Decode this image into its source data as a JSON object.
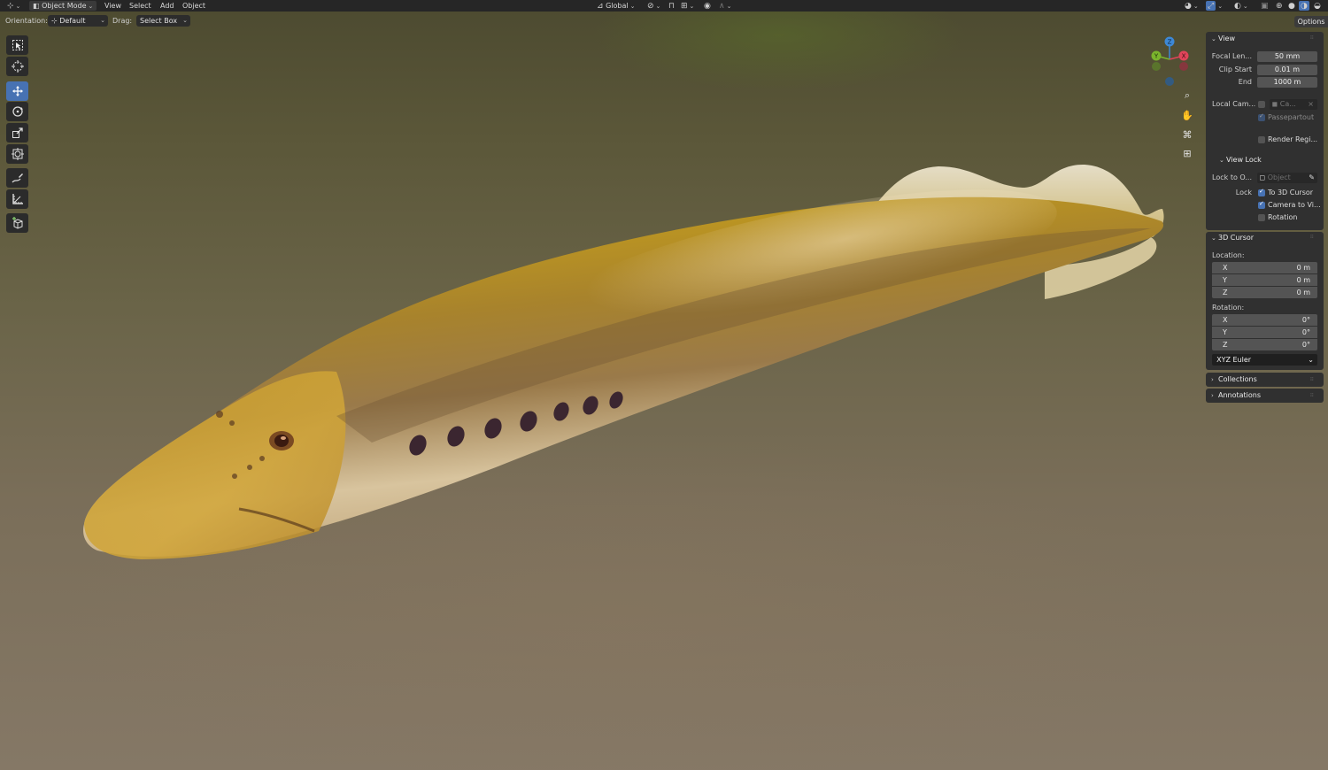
{
  "header": {
    "mode": "Object Mode",
    "menus": [
      "View",
      "Select",
      "Add",
      "Object"
    ],
    "transform_orientation": "Global"
  },
  "tool_header": {
    "orientation_label": "Orientation:",
    "orientation_value": "Default",
    "drag_label": "Drag:",
    "drag_value": "Select Box",
    "options": "Options"
  },
  "toolbar": {
    "tools": [
      "select-box",
      "cursor",
      "move",
      "rotate",
      "scale",
      "transform",
      "annotate",
      "measure",
      "add-cube"
    ],
    "active_tool": "move"
  },
  "gizmo": {
    "x": "X",
    "y": "Y",
    "z": "Z"
  },
  "sidebar": {
    "view": {
      "title": "View",
      "focal_length_label": "Focal Len...",
      "focal_length": "50 mm",
      "clip_start_label": "Clip Start",
      "clip_start": "0.01 m",
      "end_label": "End",
      "end": "1000 m",
      "local_camera_label": "Local Cam...",
      "local_camera_value": "Ca...",
      "passepartout": "Passepartout",
      "render_region": "Render Regi..."
    },
    "view_lock": {
      "title": "View Lock",
      "lock_to_object_label": "Lock to O...",
      "lock_to_object_placeholder": "Object",
      "lock_label": "Lock",
      "to_3d_cursor": "To 3D Cursor",
      "camera_to_view": "Camera to Vi...",
      "rotation": "Rotation"
    },
    "cursor": {
      "title": "3D Cursor",
      "location_label": "Location:",
      "location": [
        {
          "axis": "X",
          "value": "0 m"
        },
        {
          "axis": "Y",
          "value": "0 m"
        },
        {
          "axis": "Z",
          "value": "0 m"
        }
      ],
      "rotation_label": "Rotation:",
      "rotation": [
        {
          "axis": "X",
          "value": "0°"
        },
        {
          "axis": "Y",
          "value": "0°"
        },
        {
          "axis": "Z",
          "value": "0°"
        }
      ],
      "rotation_mode": "XYZ Euler"
    },
    "collections": {
      "title": "Collections"
    },
    "annotations": {
      "title": "Annotations"
    }
  },
  "colors": {
    "accent": "#4772b3",
    "axis_x": "#e0445a",
    "axis_y": "#7ab42c",
    "axis_z": "#3d88d6"
  }
}
